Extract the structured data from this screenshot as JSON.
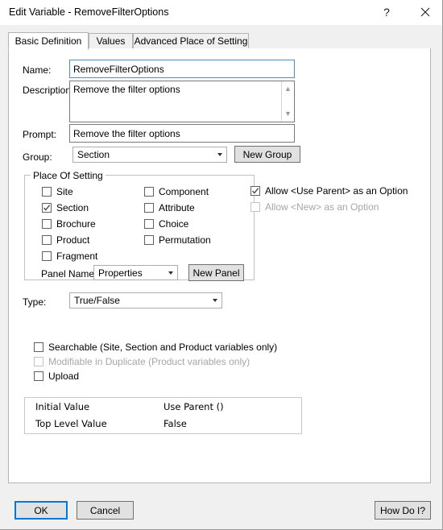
{
  "window": {
    "title": "Edit Variable - RemoveFilterOptions",
    "help_icon": "question-mark-icon",
    "close_icon": "close-icon"
  },
  "tabs": [
    {
      "label": "Basic Definition",
      "active": true
    },
    {
      "label": "Values",
      "active": false
    },
    {
      "label": "Advanced Place of Setting",
      "active": false
    }
  ],
  "form": {
    "name_label": "Name:",
    "name_value": "RemoveFilterOptions",
    "description_label": "Description:",
    "description_value": "Remove the filter options",
    "prompt_label": "Prompt:",
    "prompt_value": "Remove the filter options",
    "group_label": "Group:",
    "group_value": "Section",
    "new_group_button": "New Group",
    "type_label": "Type:",
    "type_value": "True/False"
  },
  "place_of_setting": {
    "legend": "Place Of Setting",
    "left_column": [
      {
        "label": "Site",
        "checked": false,
        "enabled": true
      },
      {
        "label": "Section",
        "checked": true,
        "enabled": true
      },
      {
        "label": "Brochure",
        "checked": false,
        "enabled": true
      },
      {
        "label": "Product",
        "checked": false,
        "enabled": true
      },
      {
        "label": "Fragment",
        "checked": false,
        "enabled": true
      }
    ],
    "right_column": [
      {
        "label": "Component",
        "checked": false,
        "enabled": true
      },
      {
        "label": "Attribute",
        "checked": false,
        "enabled": true
      },
      {
        "label": "Choice",
        "checked": false,
        "enabled": true
      },
      {
        "label": "Permutation",
        "checked": false,
        "enabled": true
      }
    ],
    "panel_name_label": "Panel Name:",
    "panel_name_value": "Properties",
    "new_panel_button": "New Panel"
  },
  "options": [
    {
      "label": "Allow <Use Parent> as an Option",
      "checked": true,
      "enabled": true
    },
    {
      "label": "Allow <New> as an Option",
      "checked": false,
      "enabled": false
    }
  ],
  "flags": [
    {
      "label": "Searchable (Site, Section and Product variables only)",
      "checked": false,
      "enabled": true
    },
    {
      "label": "Modifiable in Duplicate (Product variables only)",
      "checked": false,
      "enabled": false
    },
    {
      "label": "Upload",
      "checked": false,
      "enabled": true
    }
  ],
  "value_table": {
    "rows": [
      {
        "key": "Initial Value",
        "value": "Use Parent ()"
      },
      {
        "key": "Top Level Value",
        "value": "False"
      }
    ]
  },
  "footer": {
    "ok_button": "OK",
    "cancel_button": "Cancel",
    "how_do_i_button": "How Do I?"
  },
  "colors": {
    "focus_blue": "#0078d7",
    "panel_bg": "#ffffff",
    "dialog_bg": "#f0f0f0"
  }
}
